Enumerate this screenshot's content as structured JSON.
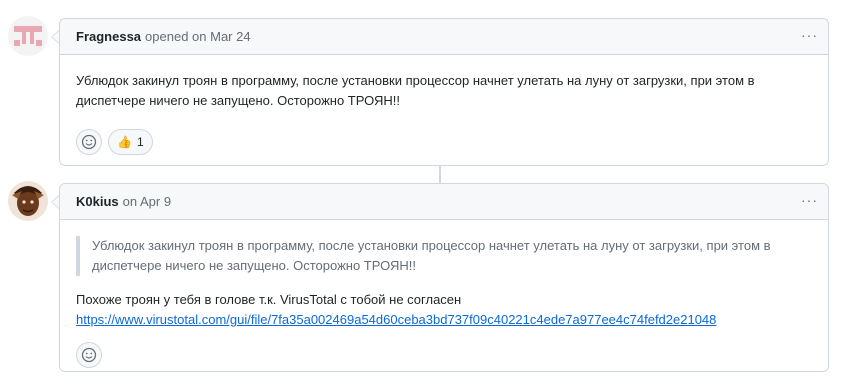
{
  "comments": [
    {
      "author": "Fragnessa",
      "action": "opened on",
      "date": "Mar 24",
      "body": "Ублюдок закинул троян в программу, после установки процессор начнет улетать на луну от загрузки, при этом в диспетчере ничего не запущено. Осторожно ТРОЯН!!",
      "reactions": [
        {
          "icon": "thumbs-up-icon",
          "emoji": "👍",
          "count": "1"
        }
      ],
      "avatar_color": "#e8a7b2"
    },
    {
      "author": "K0kius",
      "action": "on",
      "date": "Apr 9",
      "quote": "Ублюдок закинул троян в программу, после установки процессор начнет улетать на луну от загрузки, при этом в диспетчере ничего не запущено. Осторожно ТРОЯН!!",
      "body": "Похоже троян у тебя в голове т.к. VirusTotal с тобой не согласен",
      "link": "https://www.virustotal.com/gui/file/7fa35a002469a54d60ceba3bd737f09c40221c4ede7a977ee4c74fefd2e21048"
    }
  ],
  "menu_glyph": "···"
}
